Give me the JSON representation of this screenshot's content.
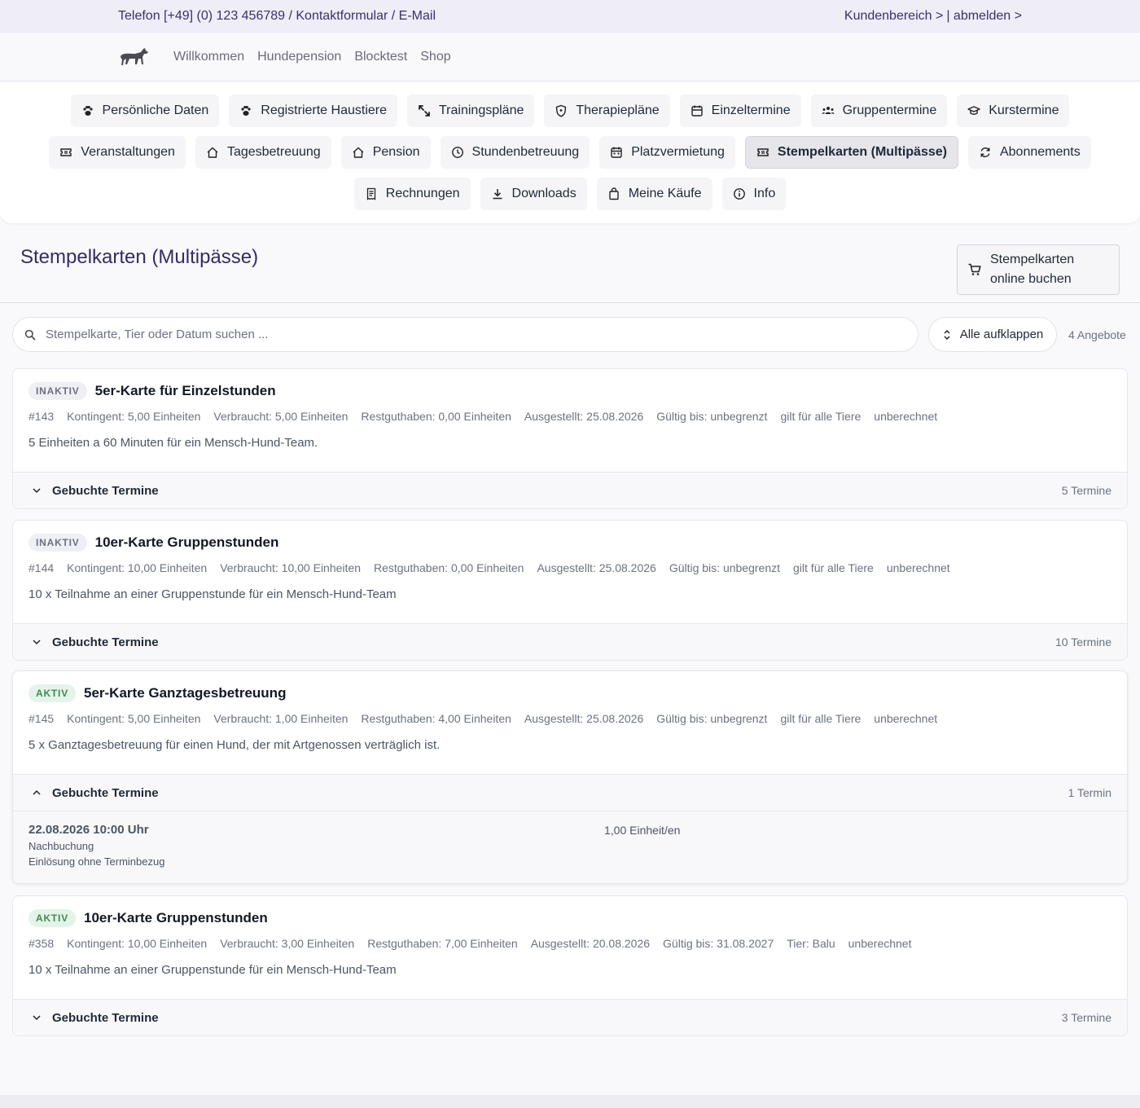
{
  "topbar": {
    "contact": "Telefon [+49] (0) 123 456789 / Kontaktformular / E-Mail",
    "account": "Kundenbereich >",
    "logout": "| abmelden >"
  },
  "nav": {
    "logo_icon": "dog-logo-icon",
    "links": [
      "Willkommen",
      "Hundepension",
      "Blocktest",
      "Shop"
    ]
  },
  "menu": {
    "row1": [
      {
        "label": "Persönliche Daten",
        "icon": "paw-icon"
      },
      {
        "label": "Registrierte Haustiere",
        "icon": "paw-icon"
      },
      {
        "label": "Trainingspläne",
        "icon": "route-icon"
      },
      {
        "label": "Therapiepläne",
        "icon": "shield-icon"
      },
      {
        "label": "Einzeltermine",
        "icon": "calendar-icon"
      },
      {
        "label": "Gruppentermine",
        "icon": "group-icon"
      },
      {
        "label": "Kurstermine",
        "icon": "graduation-cap-icon"
      }
    ],
    "row2": [
      {
        "label": "Veranstaltungen",
        "icon": "ticket-icon"
      },
      {
        "label": "Tagesbetreuung",
        "icon": "home-icon"
      },
      {
        "label": "Pension",
        "icon": "home-icon"
      },
      {
        "label": "Stundenbetreuung",
        "icon": "clock-icon"
      },
      {
        "label": "Platzvermietung",
        "icon": "calendar-grid-icon"
      },
      {
        "label": "Stempelkarten (Multipässe)",
        "icon": "ticket-icon",
        "active": true
      },
      {
        "label": "Abonnements",
        "icon": "refresh-icon"
      }
    ],
    "row3": [
      {
        "label": "Rechnungen",
        "icon": "receipt-icon"
      },
      {
        "label": "Downloads",
        "icon": "download-icon"
      },
      {
        "label": "Meine Käufe",
        "icon": "bag-icon"
      },
      {
        "label": "Info",
        "icon": "info-icon"
      }
    ]
  },
  "page": {
    "title": "Stempelkarten (Multipässe)",
    "book_line1": "Stempelkarten",
    "book_line2": "online buchen"
  },
  "search": {
    "placeholder": "Stempelkarte, Tier oder Datum suchen ...",
    "expand_label": "Alle aufklappen",
    "count": "4 Angebote"
  },
  "cards": [
    {
      "status": "INAKTIV",
      "title": "5er-Karte für Einzelstunden",
      "meta": [
        "#143",
        "Kontingent: 5,00 Einheiten",
        "Verbraucht: 5,00 Einheiten",
        "Restguthaben: 0,00 Einheiten",
        "Ausgestellt: 25.08.2026",
        "Gültig bis: unbegrenzt",
        "gilt für alle Tiere",
        "unberechnet"
      ],
      "description": "5 Einheiten a 60 Minuten für ein Mensch-Hund-Team.",
      "accordion_label": "Gebuchte Termine",
      "accordion_count": "5 Termine"
    },
    {
      "status": "INAKTIV",
      "title": "10er-Karte Gruppenstunden",
      "meta": [
        "#144",
        "Kontingent: 10,00 Einheiten",
        "Verbraucht: 10,00 Einheiten",
        "Restguthaben: 0,00 Einheiten",
        "Ausgestellt: 25.08.2026",
        "Gültig bis: unbegrenzt",
        "gilt für alle Tiere",
        "unberechnet"
      ],
      "description": "10 x Teilnahme an einer Gruppenstunde für ein Mensch-Hund-Team",
      "accordion_label": "Gebuchte Termine",
      "accordion_count": "10 Termine"
    },
    {
      "status": "AKTIV",
      "title": "5er-Karte Ganztagesbetreuung",
      "meta": [
        "#145",
        "Kontingent: 5,00 Einheiten",
        "Verbraucht: 1,00 Einheiten",
        "Restguthaben: 4,00 Einheiten",
        "Ausgestellt: 25.08.2026",
        "Gültig bis: unbegrenzt",
        "gilt für alle Tiere",
        "unberechnet"
      ],
      "description": "5 x Ganztagesbetreuung für einen Hund, der mit Artgenossen verträglich ist.",
      "accordion_label": "Gebuchte Termine",
      "accordion_count": "1 Termin",
      "appointment": {
        "date": "22.08.2026 10:00 Uhr",
        "type": "Nachbuchung",
        "note": "Einlösung ohne Terminbezug",
        "units": "1,00 Einheit/en"
      }
    },
    {
      "status": "AKTIV",
      "title": "10er-Karte Gruppenstunden",
      "meta": [
        "#358",
        "Kontingent: 10,00 Einheiten",
        "Verbraucht: 3,00 Einheiten",
        "Restguthaben: 7,00 Einheiten",
        "Ausgestellt: 20.08.2026",
        "Gültig bis: 31.08.2027",
        "Tier: Balu",
        "unberechnet"
      ],
      "description": "10 x Teilnahme an einer Gruppenstunde für ein Mensch-Hund-Team",
      "accordion_label": "Gebuchte Termine",
      "accordion_count": "3 Termine"
    }
  ]
}
